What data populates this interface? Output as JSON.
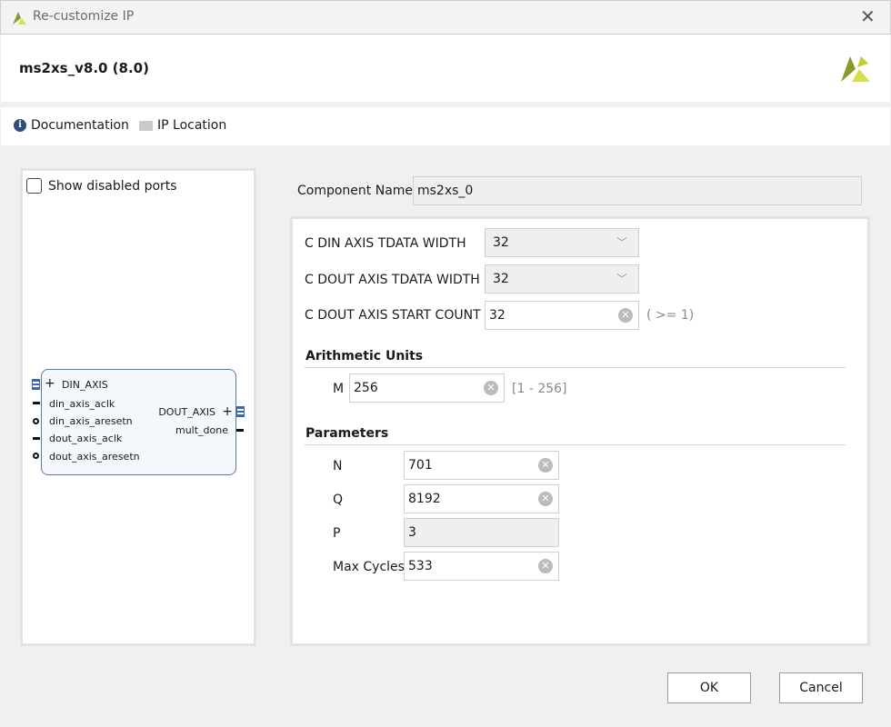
{
  "window": {
    "title": "Re-customize IP"
  },
  "header": {
    "ip_name": "ms2xs_v8.0 (8.0)"
  },
  "toolbar": {
    "documentation": "Documentation",
    "ip_location": "IP Location"
  },
  "left": {
    "show_disabled_ports": "Show disabled ports",
    "show_disabled_checked": false,
    "block": {
      "in_bus": "DIN_AXIS",
      "in_ports": [
        "din_axis_aclk",
        "din_axis_aresetn",
        "dout_axis_aclk",
        "dout_axis_aresetn"
      ],
      "out_bus": "DOUT_AXIS",
      "out_ports": [
        "mult_done"
      ]
    }
  },
  "form": {
    "component_name_label": "Component Name",
    "component_name": "ms2xs_0",
    "din_width_label": "C DIN AXIS TDATA WIDTH",
    "din_width": "32",
    "dout_width_label": "C DOUT AXIS TDATA WIDTH",
    "dout_width": "32",
    "start_count_label": "C DOUT AXIS START COUNT",
    "start_count": "32",
    "start_count_hint": "( >= 1)",
    "arith_title": "Arithmetic Units",
    "m_label": "M",
    "m": "256",
    "m_hint": "[1 - 256]",
    "params_title": "Parameters",
    "n_label": "N",
    "n": "701",
    "q_label": "Q",
    "q": "8192",
    "p_label": "P",
    "p": "3",
    "max_cycles_label": "Max Cycles",
    "max_cycles": "533"
  },
  "buttons": {
    "ok": "OK",
    "cancel": "Cancel"
  }
}
